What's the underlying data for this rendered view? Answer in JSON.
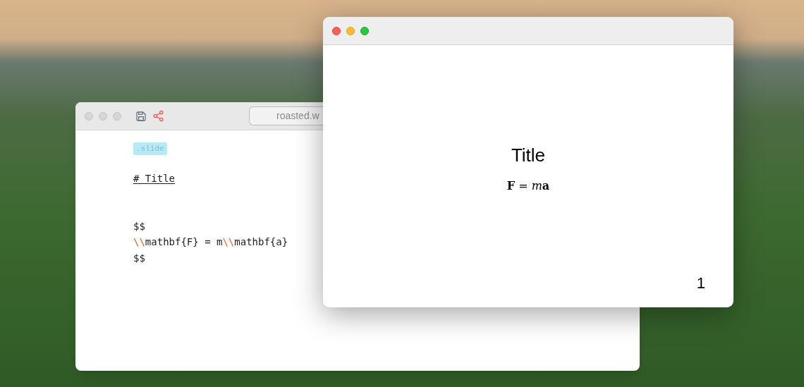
{
  "editor_window": {
    "url": "roasted.w",
    "tag": ".slide",
    "lines": [
      {
        "kind": "heading",
        "segments": [
          {
            "kind": "text",
            "text": "# Title"
          }
        ]
      },
      {
        "kind": "blank"
      },
      {
        "kind": "code",
        "segments": [
          {
            "kind": "text",
            "text": "$$"
          }
        ]
      },
      {
        "kind": "code",
        "segments": [
          {
            "kind": "escape",
            "text": "\\\\"
          },
          {
            "kind": "text",
            "text": "mathbf{F} = m"
          },
          {
            "kind": "escape",
            "text": "\\\\"
          },
          {
            "kind": "text",
            "text": "mathbf{a}"
          }
        ]
      },
      {
        "kind": "code",
        "segments": [
          {
            "kind": "text",
            "text": "$$"
          }
        ]
      }
    ]
  },
  "preview_window": {
    "slide": {
      "title": "Title",
      "formula": [
        {
          "kind": "bold",
          "text": "F"
        },
        {
          "kind": "plain",
          "text": " = "
        },
        {
          "kind": "italic",
          "text": "m"
        },
        {
          "kind": "bold",
          "text": "a"
        }
      ],
      "page_number": "1"
    }
  }
}
